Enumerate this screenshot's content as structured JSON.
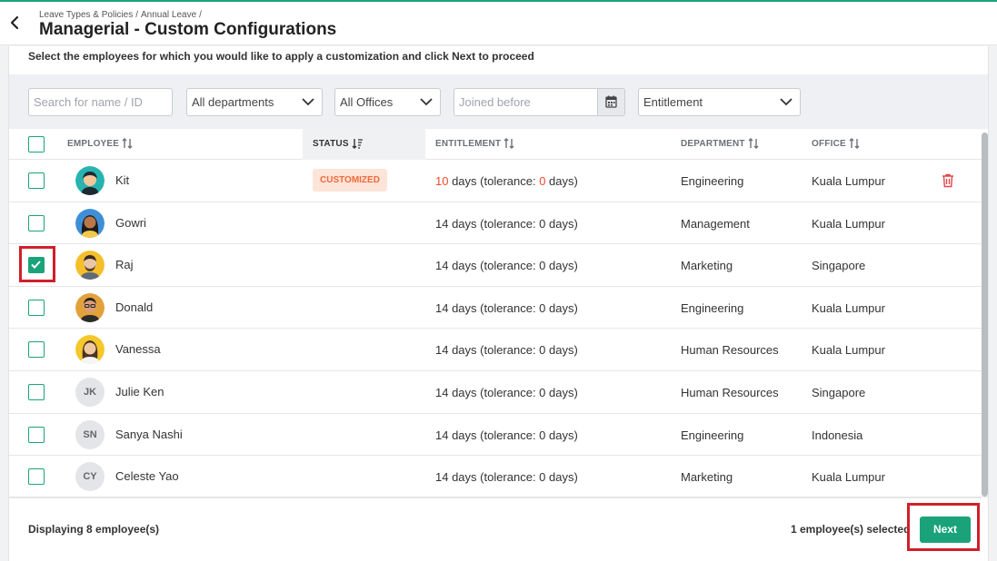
{
  "header": {
    "breadcrumb": [
      "Leave Types & Policies",
      "Annual Leave"
    ],
    "breadcrumb_separator": "/",
    "title": "Managerial - Custom Configurations"
  },
  "instruction": "Select the employees for which you would like to apply a customization and click Next to proceed",
  "filters": {
    "search_placeholder": "Search for name / ID",
    "department": "All departments",
    "office": "All Offices",
    "joined_placeholder": "Joined before",
    "entitlement": "Entitlement"
  },
  "columns": {
    "employee": "EMPLOYEE",
    "status": "STATUS",
    "entitlement": "ENTITLEMENT",
    "department": "DEPARTMENT",
    "office": "OFFICE"
  },
  "rows": [
    {
      "name": "Kit",
      "avatar": "avatar-teal-hair",
      "status": "CUSTOMIZED",
      "ent_days": "10",
      "ent_tol": "0",
      "ent_prefix": "",
      "ent_mid": " days (tolerance: ",
      "ent_suffix": " days)",
      "department": "Engineering",
      "office": "Kuala Lumpur",
      "checked": false,
      "highlight": true
    },
    {
      "name": "Gowri",
      "avatar": "avatar-dark-hair",
      "status": "",
      "entitlement": "14 days (tolerance: 0 days)",
      "department": "Management",
      "office": "Kuala Lumpur",
      "checked": false
    },
    {
      "name": "Raj",
      "avatar": "avatar-beard",
      "status": "",
      "entitlement": "14 days (tolerance: 0 days)",
      "department": "Marketing",
      "office": "Singapore",
      "checked": true
    },
    {
      "name": "Donald",
      "avatar": "avatar-glasses",
      "status": "",
      "entitlement": "14 days (tolerance: 0 days)",
      "department": "Engineering",
      "office": "Kuala Lumpur",
      "checked": false
    },
    {
      "name": "Vanessa",
      "avatar": "avatar-long-hair",
      "status": "",
      "entitlement": "14 days (tolerance: 0 days)",
      "department": "Human Resources",
      "office": "Kuala Lumpur",
      "checked": false
    },
    {
      "name": "Julie Ken",
      "initials": "JK",
      "status": "",
      "entitlement": "14 days (tolerance: 0 days)",
      "department": "Human Resources",
      "office": "Singapore",
      "checked": false
    },
    {
      "name": "Sanya Nashi",
      "initials": "SN",
      "status": "",
      "entitlement": "14 days (tolerance: 0 days)",
      "department": "Engineering",
      "office": "Indonesia",
      "checked": false
    },
    {
      "name": "Celeste Yao",
      "initials": "CY",
      "status": "",
      "entitlement": "14 days (tolerance: 0 days)",
      "department": "Marketing",
      "office": "Kuala Lumpur",
      "checked": false
    }
  ],
  "footer": {
    "displaying": "Displaying 8 employee(s)",
    "selected": "1 employee(s) selected",
    "next_label": "Next"
  },
  "colors": {
    "accent": "#1aa37a",
    "badge_bg": "#fde4d8",
    "badge_text": "#ef6a3a",
    "highlight_red": "#d11f2a",
    "delete_icon": "#e0474c"
  }
}
